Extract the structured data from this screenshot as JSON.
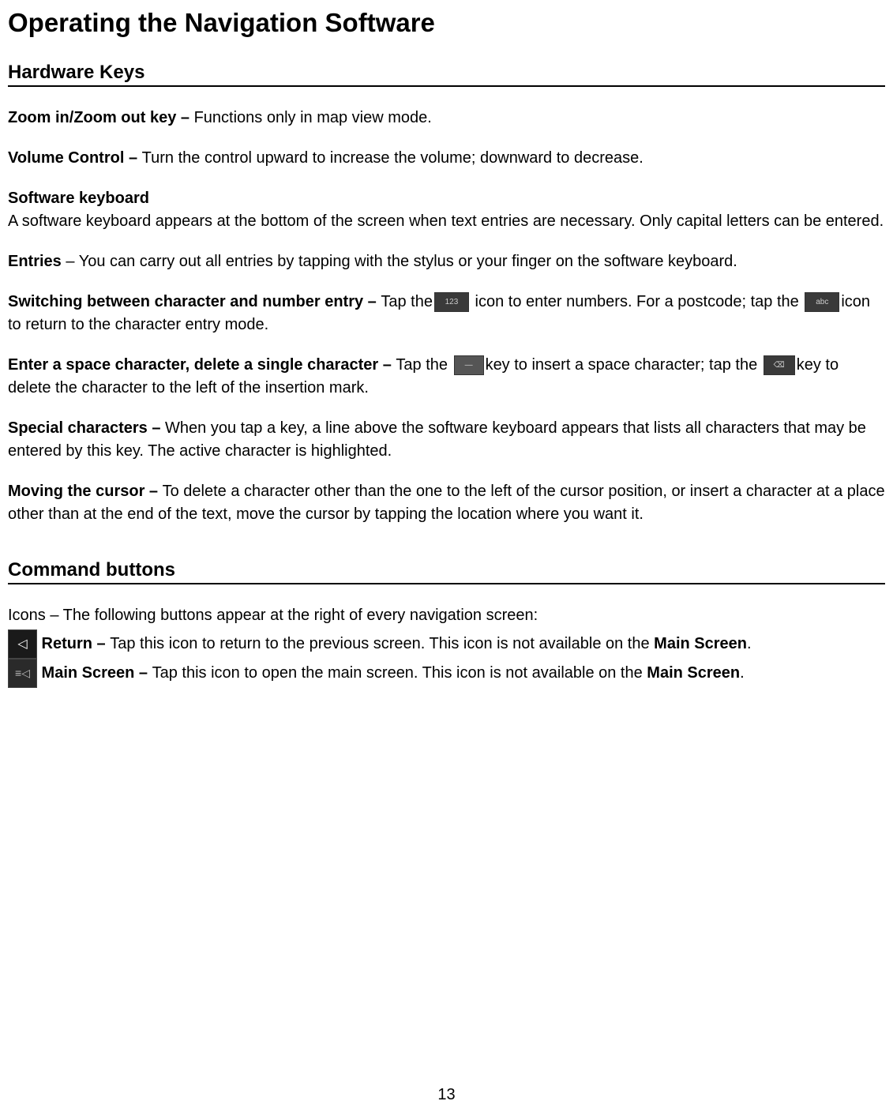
{
  "title": "Operating the Navigation Software",
  "section1": {
    "heading": "Hardware Keys",
    "zoom": {
      "label": "Zoom in/Zoom out key – ",
      "text": "Functions only in map view mode."
    },
    "volume": {
      "label": "Volume Control – ",
      "text": "Turn the control upward to increase the volume; downward to decrease."
    },
    "softkbd": {
      "label": "Software keyboard",
      "text": "A software keyboard appears at the bottom of the screen when text entries are necessary. Only capital letters can be entered."
    },
    "entries": {
      "label": "Entries",
      "dash": " – ",
      "text": "You can carry out all entries by tapping with the stylus or your finger on the software keyboard."
    },
    "switching": {
      "label": "Switching between character and number entry – ",
      "text1": "Tap the",
      "text2": " icon to enter numbers. For a postcode; tap the ",
      "text3": "icon to return to the character entry mode."
    },
    "space": {
      "label": "Enter a space character, delete a single character – ",
      "text1": "Tap the ",
      "text2": "key to insert a space character; tap the ",
      "text3": "key to delete the character to the left of the insertion mark."
    },
    "special": {
      "label": "Special characters – ",
      "text": "When you tap a key, a line above the software keyboard appears that lists all characters that may be entered by this key. The active character is highlighted."
    },
    "cursor": {
      "label": "Moving the cursor – ",
      "text": "To delete a character other than the one to the left of the cursor position, or insert a character at a place other than at the end of the text, move the cursor by tapping the location where you want it."
    }
  },
  "section2": {
    "heading": "Command buttons",
    "icons_intro": "Icons – The following buttons appear at the right of every navigation screen:",
    "return": {
      "label": " Return – ",
      "text": "Tap this icon to return to the previous screen. This icon is not available on the ",
      "mainscreen": "Main Screen",
      "period": "."
    },
    "mainscreen": {
      "label": " Main Screen – ",
      "text": "Tap this icon to open the main screen. This icon is not available on the ",
      "mainscreen": "Main Screen",
      "period": "."
    }
  },
  "icons": {
    "num": "123",
    "abc": "abc",
    "space": "—",
    "backspace": "⌫",
    "return": "◁",
    "mainscreen": "≡◁"
  },
  "page": "13"
}
